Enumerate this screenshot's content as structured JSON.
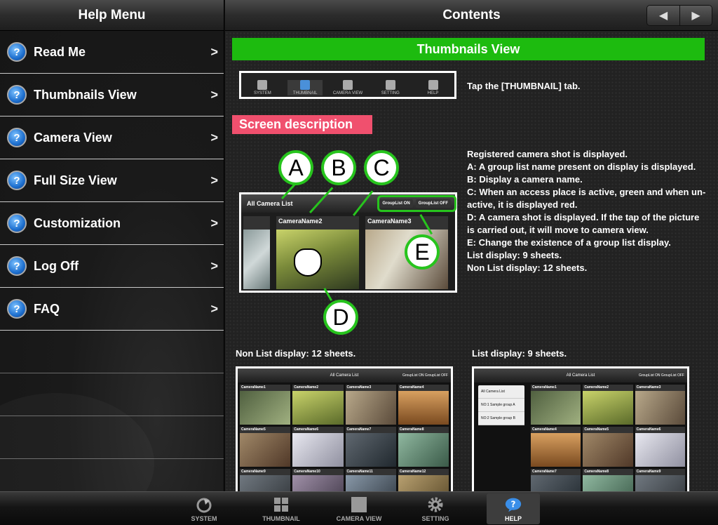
{
  "sidebar": {
    "title": "Help Menu",
    "items": [
      {
        "label": "Read Me"
      },
      {
        "label": "Thumbnails View"
      },
      {
        "label": "Camera View"
      },
      {
        "label": "Full Size View"
      },
      {
        "label": "Customization"
      },
      {
        "label": "Log Off"
      },
      {
        "label": "FAQ"
      }
    ],
    "chevron": ">",
    "icon_glyph": "?"
  },
  "content": {
    "title": "Contents",
    "section_title": "Thumbnails View",
    "tap_instruction": "Tap the [THUMBNAIL] tab.",
    "screen_description_label": "Screen description",
    "description_lines": [
      "Registered camera shot is displayed.",
      "A: A group list name present on display is displayed.",
      "B: Display a camera name.",
      "C: When an access place is active, green and when un-active, it is displayed red.",
      "D: A camera shot is displayed. If the tap of the picture is carried out, it will move to camera view.",
      "E: Change the existence of a group list display.",
      "List display: 9 sheets.",
      "Non List display: 12 sheets."
    ],
    "preview_tabs": [
      "SYSTEM",
      "THUMBNAIL",
      "CAMERA VIEW",
      "SETTING",
      "HELP"
    ],
    "annotated": {
      "header": "All Camera List",
      "group_on": "GroupList ON",
      "group_off": "GroupList OFF",
      "camera_names": [
        "CameraName2",
        "CameraName3"
      ],
      "markers": [
        "A",
        "B",
        "C",
        "D",
        "E"
      ]
    },
    "non_list_label": "Non List display: 12 sheets.",
    "list_label": "List display: 9 sheets.",
    "grid_header": "All Camera List",
    "grid_group": "GroupList ON  GroupList OFF",
    "non_list_cameras": [
      "CameraName1",
      "CameraName2",
      "CameraName3",
      "CameraName4",
      "CameraName5",
      "CameraName6",
      "CameraName7",
      "CameraName8",
      "CameraName9",
      "CameraName10",
      "CameraName11",
      "CameraName12"
    ],
    "list_cameras": [
      "CameraName1",
      "CameraName2",
      "CameraName3",
      "CameraName4",
      "CameraName5",
      "CameraName6",
      "CameraName7",
      "CameraName8",
      "CameraName9"
    ],
    "group_list_items": [
      "All Camera List",
      "NO:1 Sample group A",
      "NO:2 Sample group B"
    ]
  },
  "tabbar": {
    "tabs": [
      {
        "label": "SYSTEM",
        "icon": "system-icon"
      },
      {
        "label": "THUMBNAIL",
        "icon": "thumbnail-icon"
      },
      {
        "label": "CAMERA VIEW",
        "icon": "camera-view-icon"
      },
      {
        "label": "SETTING",
        "icon": "gear-icon"
      },
      {
        "label": "HELP",
        "icon": "help-icon"
      }
    ],
    "active": "HELP"
  },
  "colors": {
    "section_green": "#1dbb0f",
    "label_pink": "#f0506e",
    "marker_green": "#27c41d"
  }
}
